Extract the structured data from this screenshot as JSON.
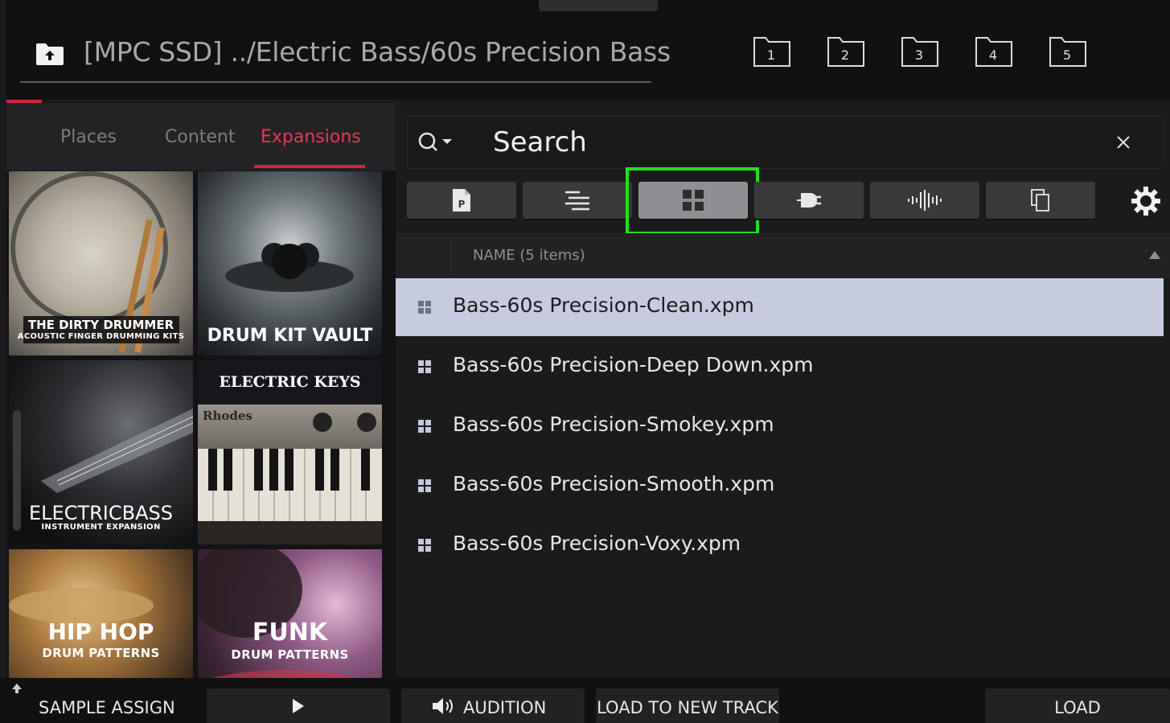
{
  "header": {
    "path": "[MPC SSD] ../Electric Bass/60s Precision Bass",
    "folders": [
      "1",
      "2",
      "3",
      "4",
      "5"
    ]
  },
  "tabs": [
    "Places",
    "Content",
    "Expansions"
  ],
  "active_tab": "Expansions",
  "expansions": [
    {
      "title": "THE DIRTY DRUMMER",
      "subtitle": "ACOUSTIC FINGER DRUMMING KITS"
    },
    {
      "title": "DRUM KIT VAULT",
      "subtitle": ""
    },
    {
      "title": "ELECTRICBASS",
      "subtitle": "INSTRUMENT EXPANSION"
    },
    {
      "title": "ELECTRIC KEYS",
      "subtitle": "Rhodes"
    },
    {
      "title": "HIP HOP",
      "subtitle": "DRUM PATTERNS"
    },
    {
      "title": "FUNK",
      "subtitle": "DRUM PATTERNS"
    }
  ],
  "search": {
    "placeholder": "Search"
  },
  "filters": [
    {
      "name": "program-filter",
      "active": false
    },
    {
      "name": "sequence-filter",
      "active": false
    },
    {
      "name": "drum-program-filter",
      "active": true
    },
    {
      "name": "plugin-filter",
      "active": false
    },
    {
      "name": "sample-filter",
      "active": false
    },
    {
      "name": "project-filter",
      "active": false
    }
  ],
  "list": {
    "header": "NAME (5 items)",
    "items": [
      "Bass-60s Precision-Clean.xpm",
      "Bass-60s Precision-Deep Down.xpm",
      "Bass-60s Precision-Smokey.xpm",
      "Bass-60s Precision-Smooth.xpm",
      "Bass-60s Precision-Voxy.xpm"
    ],
    "selected_index": 0
  },
  "footer": {
    "sample_assign": "SAMPLE ASSIGN",
    "audition": "AUDITION",
    "load_to_new_track": "LOAD TO NEW TRACK",
    "load": "LOAD"
  },
  "colors": {
    "accent": "#d8213c",
    "highlight": "#22e01a",
    "selected_row": "#c6cbe0"
  }
}
